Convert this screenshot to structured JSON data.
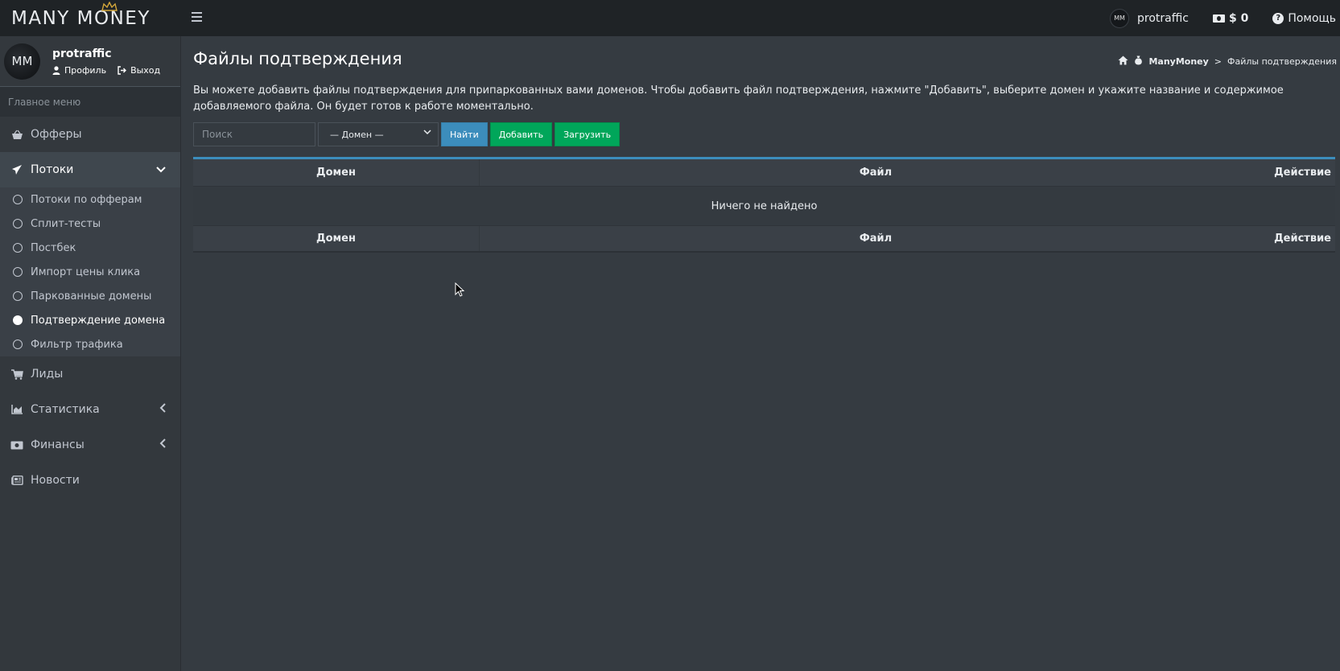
{
  "brand": {
    "logo_text": "MANY MONEY"
  },
  "topbar": {
    "username": "protraffic",
    "balance": "$ 0",
    "help": "Помощь"
  },
  "sidebar": {
    "user": {
      "name": "protraffic",
      "profile_link": "Профиль",
      "logout_link": "Выход"
    },
    "menu_header": "Главное меню",
    "items": [
      {
        "label": "Офферы",
        "icon": "basket-icon"
      },
      {
        "label": "Потоки",
        "icon": "paper-plane-icon",
        "open": true
      },
      {
        "label": "Лиды",
        "icon": "cart-icon"
      },
      {
        "label": "Статистика",
        "icon": "chart-area-icon"
      },
      {
        "label": "Финансы",
        "icon": "money-bill-icon"
      },
      {
        "label": "Новости",
        "icon": "newspaper-icon"
      }
    ],
    "subitems": [
      {
        "label": "Потоки по офферам"
      },
      {
        "label": "Сплит-тесты"
      },
      {
        "label": "Постбек"
      },
      {
        "label": "Импорт цены клика"
      },
      {
        "label": "Паркованные домены"
      },
      {
        "label": "Подтверждение домена",
        "active": true
      },
      {
        "label": "Фильтр трафика"
      }
    ]
  },
  "page": {
    "title": "Файлы подтверждения",
    "breadcrumb": {
      "root": "ManyMoney",
      "separator": ">",
      "current": "Файлы подтверждения"
    },
    "description": "Вы можете добавить файлы подтверждения для припаркованных вами доменов. Чтобы добавить файл подтверждения, нажмите \"Добавить\", выберите домен и укажите название и содержимое добавляемого файла. Он будет готов к работе моментально."
  },
  "toolbar": {
    "search_placeholder": "Поиск",
    "domain_select": "— Домен —",
    "find_label": "Найти",
    "add_label": "Добавить",
    "upload_label": "Загрузить"
  },
  "table": {
    "columns": [
      "Домен",
      "Файл",
      "Действие"
    ],
    "empty_text": "Ничего не найдено"
  },
  "colors": {
    "accent_blue": "#3c8dbc",
    "accent_green": "#00a65a",
    "background": "#353b41",
    "topbar": "#1f2326"
  }
}
